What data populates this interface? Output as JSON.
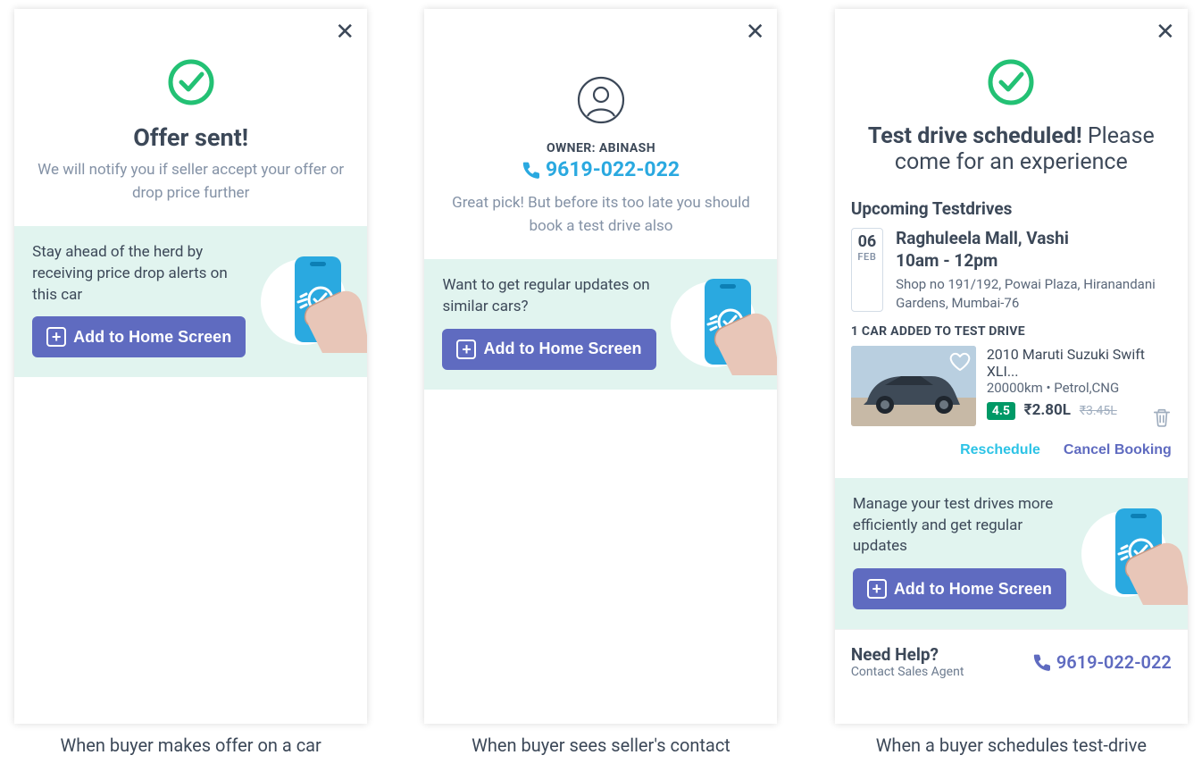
{
  "screen1": {
    "title": "Offer sent!",
    "subtitle": "We will notify you if seller accept your offer or drop price further",
    "promo_text": "Stay ahead of the herd by receiving price drop alerts on this car",
    "add_label": "Add to Home Screen",
    "caption": "When buyer makes offer on a car"
  },
  "screen2": {
    "owner_label": "OWNER: ABINASH",
    "phone": "9619-022-022",
    "subtitle": "Great pick! But before its too late you should book a test drive also",
    "promo_text": "Want to get regular updates on similar cars?",
    "add_label": "Add to Home Screen",
    "caption": "When buyer sees seller's contact"
  },
  "screen3": {
    "title_bold": "Test drive scheduled!",
    "title_rest": " Please come for an experience",
    "upcoming_label": "Upcoming Testdrives",
    "date_day": "06",
    "date_month": "FEB",
    "loc_name": "Raghuleela Mall, Vashi",
    "loc_time": "10am - 12pm",
    "loc_addr": "Shop no 191/192, Powai Plaza, Hiranandani Gardens, Mumbai-76",
    "count_label": "1 CAR ADDED TO TEST DRIVE",
    "car_title": "2010 Maruti Suzuki Swift XLI...",
    "car_sub": "20000km • Petrol,CNG",
    "rating": "4.5",
    "price": "₹2.80L",
    "old_price": "₹3.45L",
    "reschedule": "Reschedule",
    "cancel": "Cancel Booking",
    "promo_text": "Manage your test drives more efficiently and get regular updates",
    "add_label": "Add to Home Screen",
    "help_title": "Need Help?",
    "help_sub": "Contact Sales Agent",
    "help_phone": "9619-022-022",
    "caption": "When a buyer schedules test-drive"
  },
  "icons": {
    "check_color": "#23c174",
    "phone_blue": "#2aa9e0",
    "phone_purple": "#5f6bc0"
  }
}
